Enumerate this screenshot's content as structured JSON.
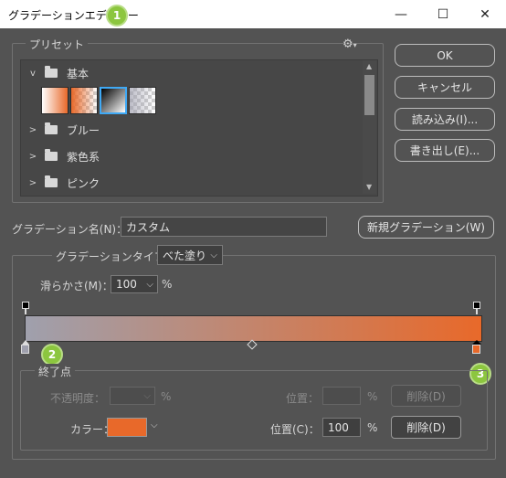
{
  "window": {
    "title": "グラデーションエディター",
    "minimize": "—",
    "maximize": "☐",
    "close": "✕"
  },
  "markers": [
    "1",
    "2",
    "3"
  ],
  "presets": {
    "legend": "プリセット",
    "gear": "⚙",
    "folders": [
      {
        "name": "基本",
        "expanded": true,
        "chevron": "v"
      },
      {
        "name": "ブルー",
        "expanded": false,
        "chevron": ">"
      },
      {
        "name": "紫色系",
        "expanded": false,
        "chevron": ">"
      },
      {
        "name": "ピンク",
        "expanded": false,
        "chevron": ">"
      }
    ]
  },
  "buttons": {
    "ok": "OK",
    "cancel": "キャンセル",
    "load": "読み込み(I)...",
    "save": "書き出し(E)...",
    "new_gradient": "新規グラデーション(W)"
  },
  "name_field": {
    "label": "グラデーション名(N)：",
    "value": "カスタム"
  },
  "type_field": {
    "label": "グラデーションタイプ：",
    "value": "べた塗り"
  },
  "smoothness": {
    "label": "滑らかさ(M)：",
    "value": "100",
    "unit": "%"
  },
  "gradient_colors": {
    "start": "#9fa0ad",
    "end": "#e8692a"
  },
  "stops": {
    "legend": "終了点",
    "opacity_label": "不透明度：",
    "opacity_unit": "%",
    "location_top_label": "位置：",
    "location_top_unit": "%",
    "delete_top": "削除(D)",
    "color_label": "カラー：",
    "color_value": "#e8692a",
    "location_label": "位置(C)：",
    "location_value": "100",
    "location_unit": "%",
    "delete": "削除(D)"
  }
}
